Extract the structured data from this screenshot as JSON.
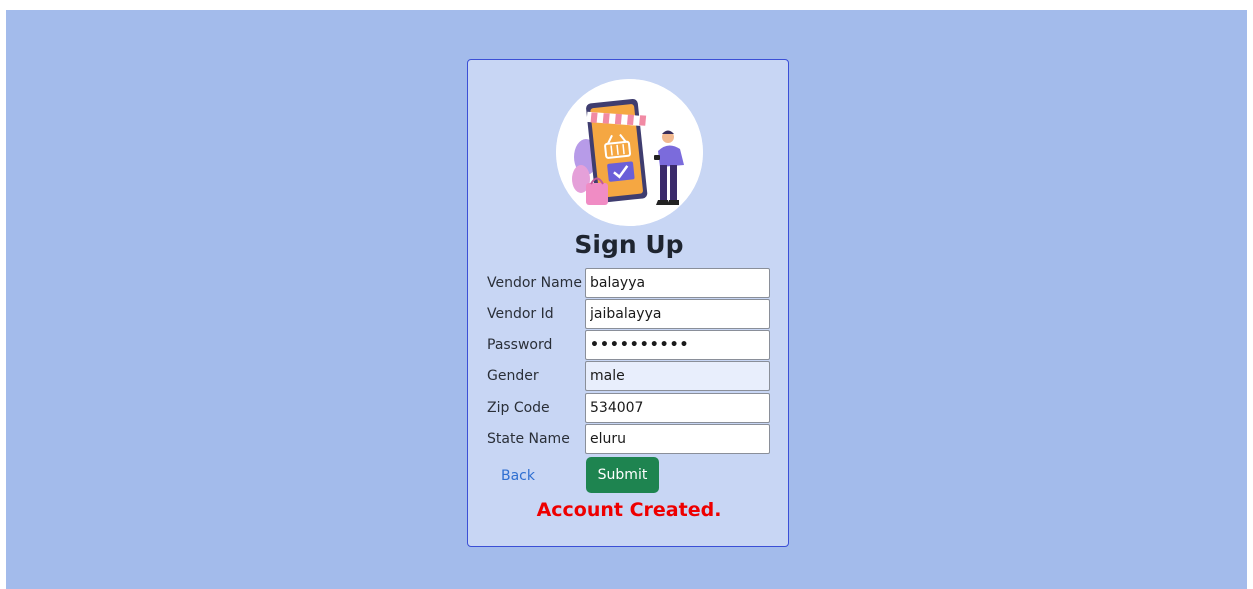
{
  "form": {
    "title": "Sign Up",
    "fields": [
      {
        "label": "Vendor Name",
        "value": "balayya"
      },
      {
        "label": "Vendor Id",
        "value": "jaibalayya"
      },
      {
        "label": "Password",
        "value": "••••••••••"
      },
      {
        "label": "Gender",
        "value": "male"
      },
      {
        "label": "Zip Code",
        "value": "534007"
      },
      {
        "label": "State Name",
        "value": "eluru"
      }
    ],
    "back_label": "Back",
    "submit_label": "Submit",
    "status_message": "Account Created."
  },
  "logo": {
    "icon": "online-shop-illustration-icon"
  },
  "colors": {
    "page_bg": "#a3bbeb",
    "card_bg": "#c8d6f4",
    "card_border": "#3b4fd6",
    "submit_bg": "#1e8450",
    "link": "#2f6fd1",
    "status": "#ee0000"
  }
}
